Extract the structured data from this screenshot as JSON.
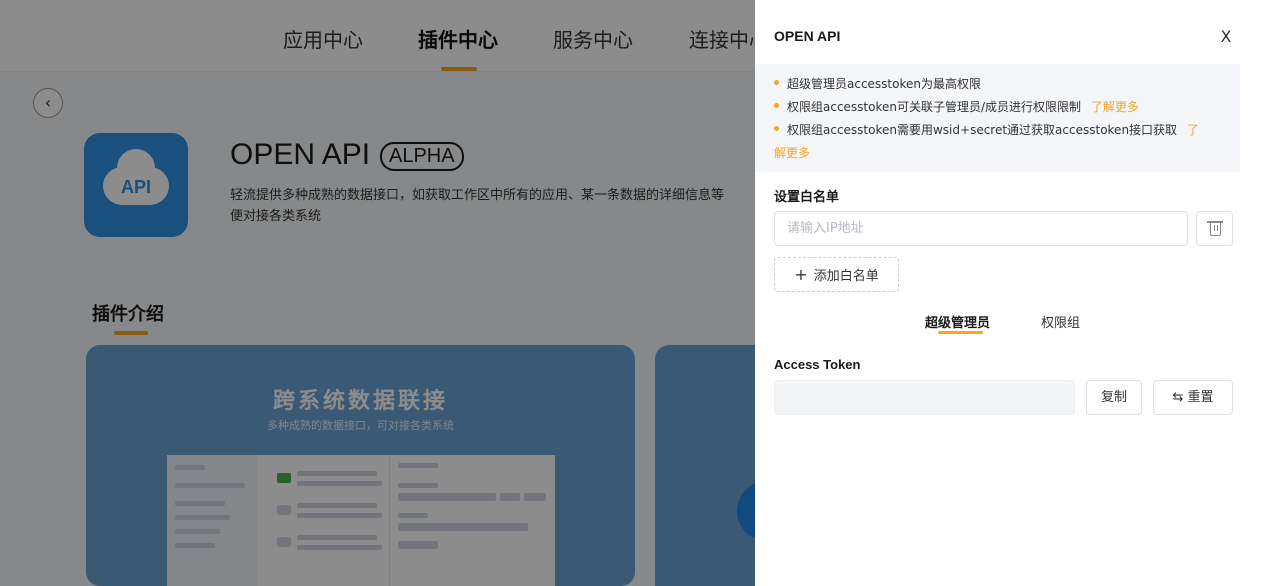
{
  "background": {
    "tabs": [
      "应用中心",
      "插件中心",
      "服务中心",
      "连接中心"
    ],
    "active_tab": "插件中心",
    "back_icon": "chevron-left-icon",
    "logo": {
      "text": "API",
      "color": "#2f93e6"
    },
    "plugin_title": "OPEN API",
    "plugin_tag": "ALPHA",
    "plugin_desc_line1": "轻流提供多种成熟的数据接口，如获取工作区中所有的应用、某一条数据的详细信息等",
    "plugin_desc_line2": "便对接各类系统",
    "section_title": "插件介绍",
    "banner_title": "跨系统数据联接",
    "banner_subtitle": "多种成熟的数据接口，可对接各类系统"
  },
  "drawer": {
    "title": "OPEN API",
    "close_icon": "close-icon",
    "notices": [
      {
        "text": "超级管理员accesstoken为最高权限",
        "link": ""
      },
      {
        "text": "权限组accesstoken可关联子管理员/成员进行权限限制",
        "link": "了解更多"
      },
      {
        "text": "权限组accesstoken需要用wsid+secret通过获取accesstoken接口获取",
        "link": "了",
        "link_cont": "解更多"
      }
    ],
    "whitelist_label": "设置白名单",
    "ip_placeholder": "请输入IP地址",
    "delete_icon": "trash-icon",
    "add_button": "添加白名单",
    "tabs": [
      "超级管理员",
      "权限组"
    ],
    "active_tab": "超级管理员",
    "token_label": "Access Token",
    "token_value": "",
    "copy_button": "复制",
    "reset_button": "重置",
    "reset_icon": "swap-icon",
    "accent_color": "#f5a623"
  }
}
